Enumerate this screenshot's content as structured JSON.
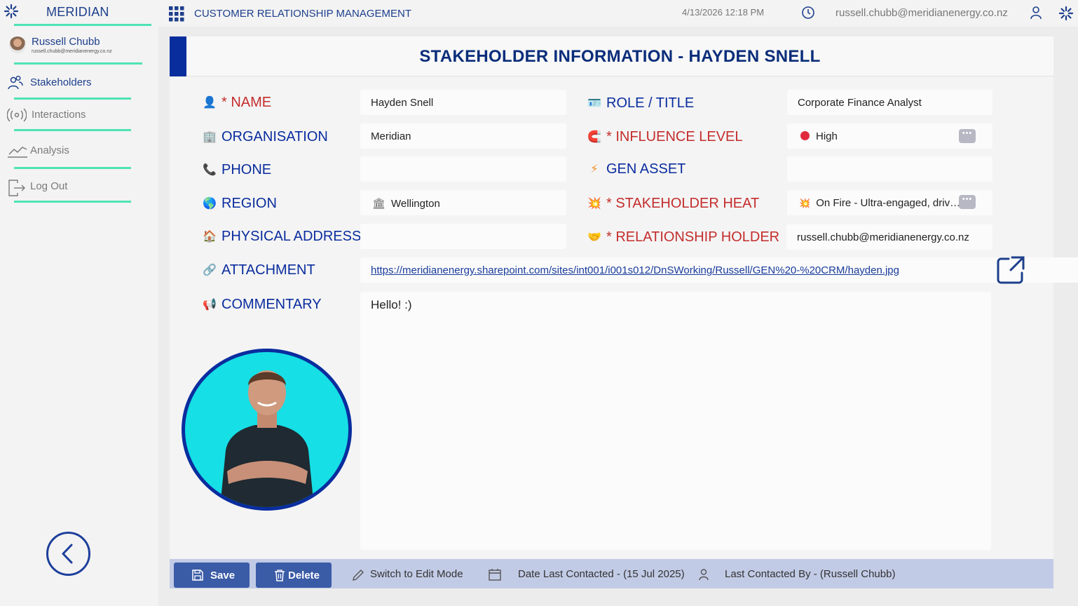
{
  "brand": {
    "name": "MERIDIAN"
  },
  "user": {
    "name": "Russell Chubb",
    "email": "russell.chubb@meridianenergy.co.nz"
  },
  "nav": [
    {
      "label": "Stakeholders",
      "icon": "stakeholders-icon",
      "active": true
    },
    {
      "label": "Interactions",
      "icon": "broadcast-icon",
      "active": false
    },
    {
      "label": "Analysis",
      "icon": "chart-line-icon",
      "active": false
    },
    {
      "label": "Log Out",
      "icon": "logout-icon",
      "active": false
    }
  ],
  "header": {
    "app_title": "CUSTOMER RELATIONSHIP MANAGEMENT",
    "datetime": "4/13/2026 12:18 PM",
    "email": "russell.chubb@meridianenergy.co.nz"
  },
  "card": {
    "title": "STAKEHOLDER INFORMATION - HAYDEN SNELL",
    "labels": {
      "name": "* NAME",
      "organisation": "ORGANISATION",
      "phone": "PHONE",
      "region": "REGION",
      "address": "PHYSICAL ADDRESS",
      "attachment": "ATTACHMENT",
      "commentary": "COMMENTARY",
      "role": "ROLE / TITLE",
      "influence": "* INFLUENCE LEVEL",
      "gen_asset": "GEN ASSET",
      "heat": "* STAKEHOLDER HEAT",
      "holder": "* RELATIONSHIP HOLDER"
    },
    "values": {
      "name": "Hayden Snell",
      "organisation": "Meridian",
      "phone": "",
      "region": "Wellington",
      "address": "",
      "attachment": "https://meridianenergy.sharepoint.com/sites/int001/i001s012/DnSWorking/Russell/GEN%20-%20CRM/hayden.jpg",
      "commentary": "Hello! :)",
      "role": "Corporate Finance Analyst",
      "influence": "High",
      "gen_asset": "",
      "heat": "On Fire - Ultra-engaged, driv….",
      "holder": "russell.chubb@meridianenergy.co.nz"
    },
    "colors": {
      "accent": "#0a2d9e",
      "label": "#0a2d9e",
      "required_label": "#c42d2d",
      "influence_high": "#e02b3c"
    }
  },
  "toolbar": {
    "save": "Save",
    "delete": "Delete",
    "edit_mode": "Switch to Edit Mode",
    "date_last_contacted": "Date Last Contacted - (15 Jul 2025)",
    "last_contacted_by": "Last Contacted By - (Russell Chubb)"
  }
}
